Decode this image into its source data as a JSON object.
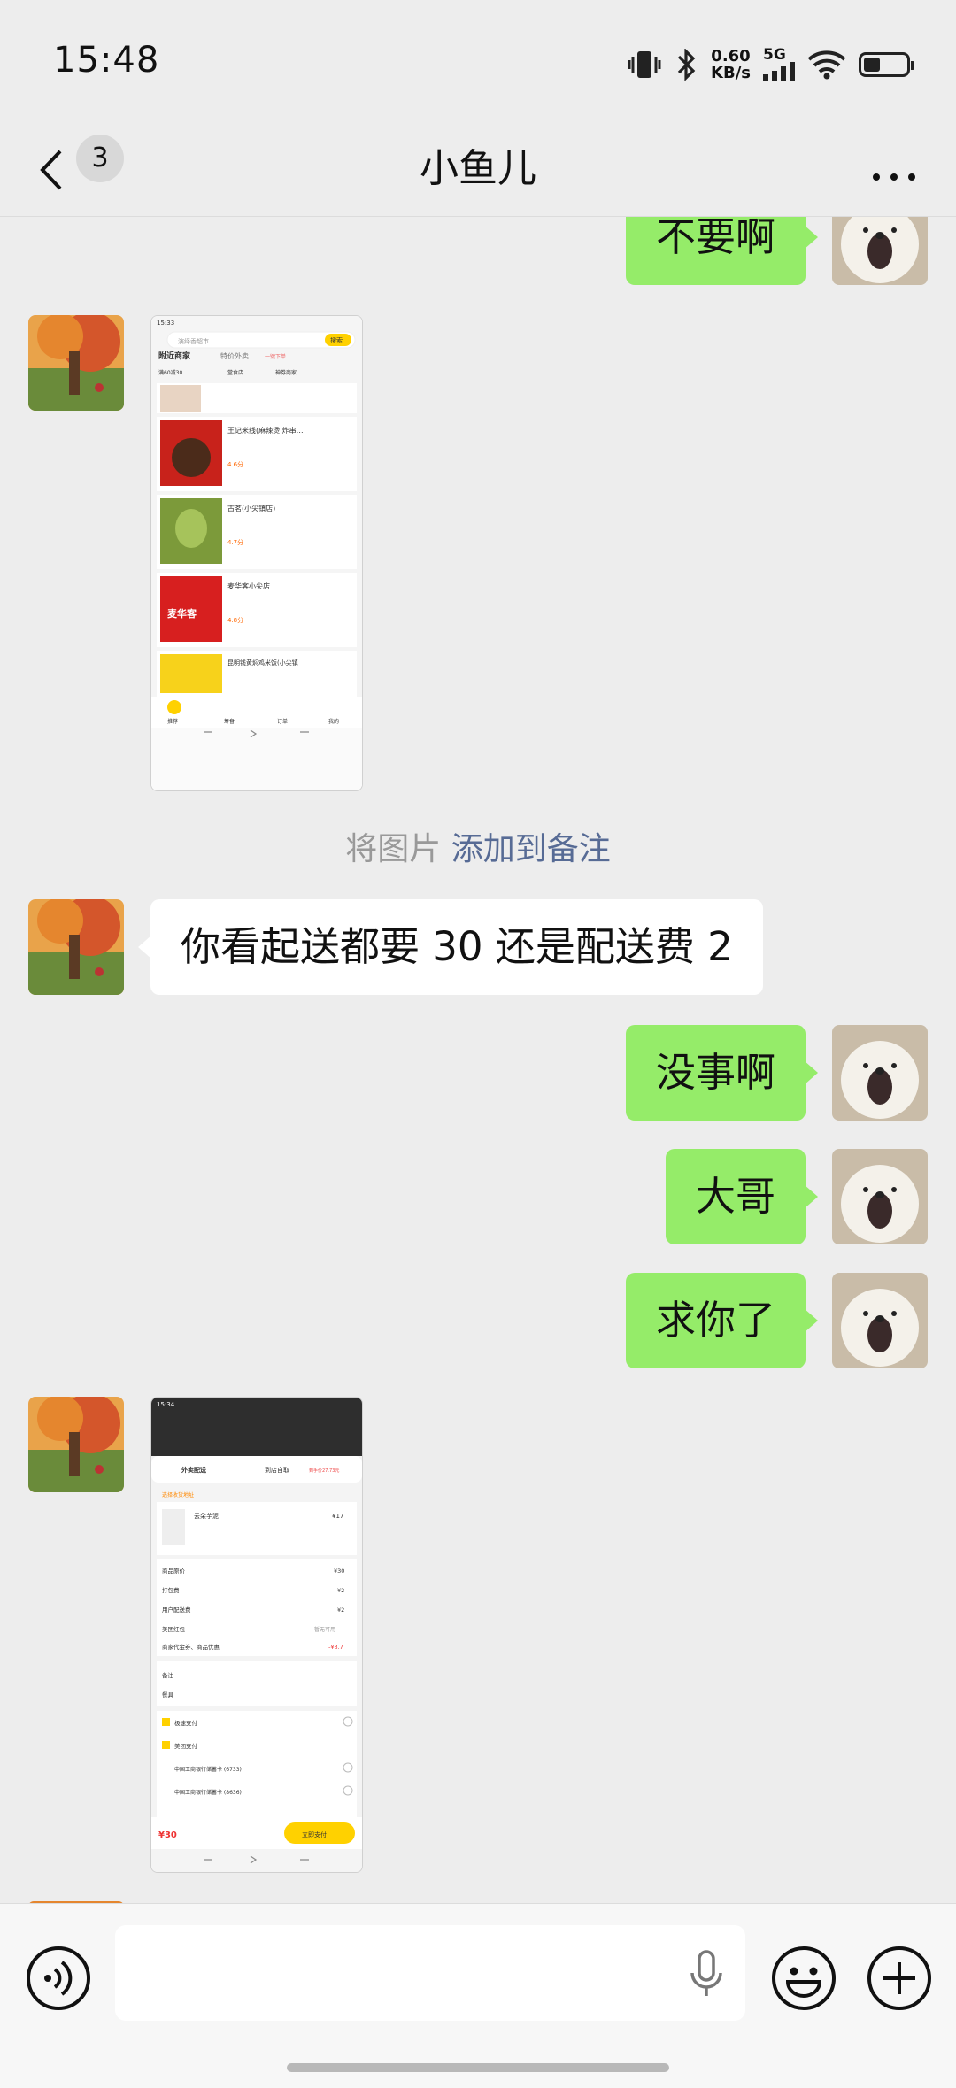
{
  "status_bar": {
    "time": "15:48",
    "net_speed_value": "0.60",
    "net_speed_unit": "KB/s",
    "network": "5G"
  },
  "nav": {
    "unread_count": "3",
    "title": "小鱼儿"
  },
  "messages": [
    {
      "side": "right",
      "type": "text",
      "text": "不要啊"
    },
    {
      "side": "left",
      "type": "image",
      "description": "screenshot-nearby-merchants"
    },
    {
      "type": "system",
      "text": "将图片",
      "link": "添加到备注"
    },
    {
      "side": "left",
      "type": "text",
      "text": "你看起送都要 30 还是配送费 2"
    },
    {
      "side": "right",
      "type": "text",
      "text": "没事啊"
    },
    {
      "side": "right",
      "type": "text",
      "text": "大哥"
    },
    {
      "side": "right",
      "type": "text",
      "text": "求你了"
    },
    {
      "side": "left",
      "type": "image",
      "description": "screenshot-order-checkout"
    }
  ],
  "screenshot1": {
    "time": "15:33",
    "search_placeholder": "演绎香超市",
    "search_btn": "搜索",
    "tab_nearby": "附近商家",
    "tab_special": "特价外卖",
    "tab_special_badge": "一键下单",
    "filter1": "满60减30",
    "filter2": "堂食店",
    "filter3": "神券商家",
    "shops": [
      {
        "name": "王记米线(麻辣烫·炸串…",
        "rating": "4.6分"
      },
      {
        "name": "古茗(小尖镇店)",
        "rating": "4.7分"
      },
      {
        "name": "麦华客小尖店",
        "rating": "4.8分"
      },
      {
        "name": "昆明钱黄焖鸡米饭(小尖镇",
        "rating": ""
      }
    ],
    "logo3_text": "麦华客",
    "nav_items": [
      "推荐",
      "筹备",
      "订单",
      "我的"
    ]
  },
  "screenshot2": {
    "time": "15:34",
    "tab_delivery": "外卖配送",
    "tab_pickup": "到店自取",
    "pickup_badge": "到手价27.73元",
    "address_hint": "选择收货地址",
    "item_name": "云朵芋泥",
    "item_price": "¥17",
    "lines": [
      {
        "label": "商品原价",
        "value": "¥30"
      },
      {
        "label": "打包费",
        "value": "¥2"
      },
      {
        "label": "用户配送费",
        "value": "¥2"
      },
      {
        "label": "美团红包",
        "value": "暂无可用"
      },
      {
        "label": "商家代金券、商品优惠",
        "value": "-¥3.7"
      }
    ],
    "remark_label": "备注",
    "tableware_label": "餐具",
    "pay_fast": "极速支付",
    "pay_meituan": "美团支付",
    "card1": "中国工商银行储蓄卡 (6733)",
    "card2": "中国工商银行储蓄卡 (8636)",
    "total": "¥30",
    "pay_btn": "立即支付"
  },
  "colors": {
    "bubble_right": "#95EC69",
    "bubble_left": "#FFFFFF",
    "background": "#EDEDED",
    "link": "#576B95"
  },
  "icons": [
    "back-icon",
    "more-icon",
    "voice-icon",
    "microphone-icon",
    "emoji-icon",
    "plus-icon"
  ]
}
